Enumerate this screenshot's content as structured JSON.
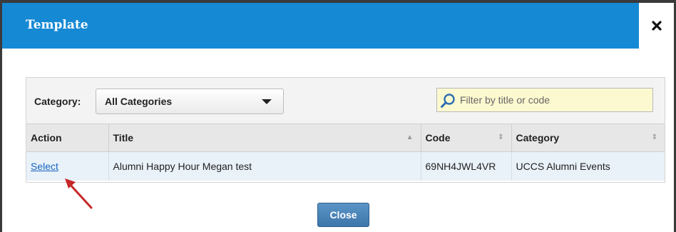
{
  "dialog": {
    "title": "Template"
  },
  "filter": {
    "category_label": "Category:",
    "category_selected": "All Categories",
    "search_placeholder": "Filter by title or code"
  },
  "table": {
    "columns": [
      {
        "label": "Action"
      },
      {
        "label": "Title"
      },
      {
        "label": "Code"
      },
      {
        "label": "Category"
      }
    ],
    "rows": [
      {
        "action": "Select",
        "title": "Alumni Happy Hour Megan test",
        "code": "69NH4JWL4VR",
        "category": "UCCS Alumni Events"
      }
    ]
  },
  "footer": {
    "close_label": "Close"
  },
  "colors": {
    "titlebar": "#1689d4",
    "annotation_arrow": "#c62828",
    "link": "#1565c0",
    "search_bg": "#fcf9d0"
  },
  "icons": {
    "close": "close-x-icon",
    "search": "search-icon",
    "dropdown": "chevron-down-icon",
    "sort": "sort-icon",
    "annotation": "arrow-icon"
  }
}
